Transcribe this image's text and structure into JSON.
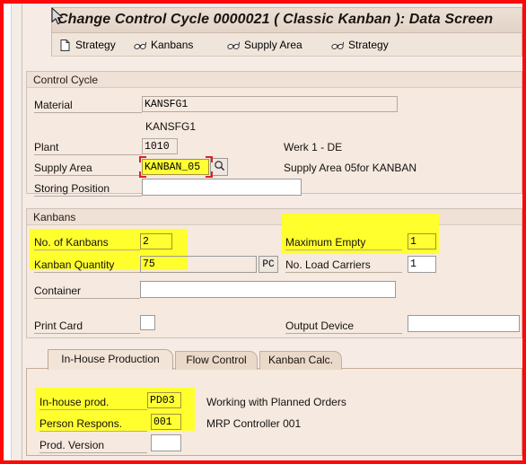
{
  "window": {
    "title": "Change Control Cycle 0000021 ( Classic Kanban ): Data Screen"
  },
  "toolbar": {
    "items": [
      {
        "label": "Strategy",
        "icon": "document-icon"
      },
      {
        "label": "Kanbans",
        "icon": "glasses-display-icon"
      },
      {
        "label": "Supply Area",
        "icon": "glasses-display-icon"
      },
      {
        "label": "Strategy",
        "icon": "glasses-display-icon"
      }
    ]
  },
  "control_cycle": {
    "group_title": "Control Cycle",
    "material": {
      "label": "Material",
      "value": "KANSFG1"
    },
    "material_desc": "KANSFG1",
    "plant": {
      "label": "Plant",
      "value": "1010",
      "desc": "Werk 1 - DE"
    },
    "supply_area": {
      "label": "Supply Area",
      "value": "KANBAN_05",
      "desc": "Supply Area 05for KANBAN",
      "search_help_icon": "magnifier-icon"
    },
    "storing_position": {
      "label": "Storing Position",
      "value": ""
    }
  },
  "kanbans": {
    "group_title": "Kanbans",
    "no_of_kanbans": {
      "label": "No. of Kanbans",
      "value": "2"
    },
    "maximum_empty": {
      "label": "Maximum Empty",
      "value": "1"
    },
    "kanban_quantity": {
      "label": "Kanban Quantity",
      "value": "75",
      "uom": "PC"
    },
    "no_load_carriers": {
      "label": "No. Load Carriers",
      "value": "1"
    },
    "container": {
      "label": "Container",
      "value": ""
    },
    "print_card": {
      "label": "Print Card",
      "checked": false
    },
    "output_device": {
      "label": "Output Device",
      "value": ""
    }
  },
  "tabs": [
    {
      "label": "In-House Production",
      "selected": true
    },
    {
      "label": "Flow Control",
      "selected": false
    },
    {
      "label": "Kanban Calc.",
      "selected": false
    }
  ],
  "in_house_production": {
    "in_house_prod": {
      "label": "In-house prod.",
      "value": "PD03",
      "desc": "Working with Planned Orders"
    },
    "person_respons": {
      "label": "Person Respons.",
      "value": "001",
      "desc": "MRP Controller 001"
    },
    "prod_version": {
      "label": "Prod. Version",
      "value": ""
    }
  },
  "colors": {
    "annotation_border": "#fd0808",
    "highlight": "#ffff2e",
    "focus_marker": "#e02020",
    "panel_bg": "#f5e9e0",
    "title_bg": "#e8dacd"
  }
}
